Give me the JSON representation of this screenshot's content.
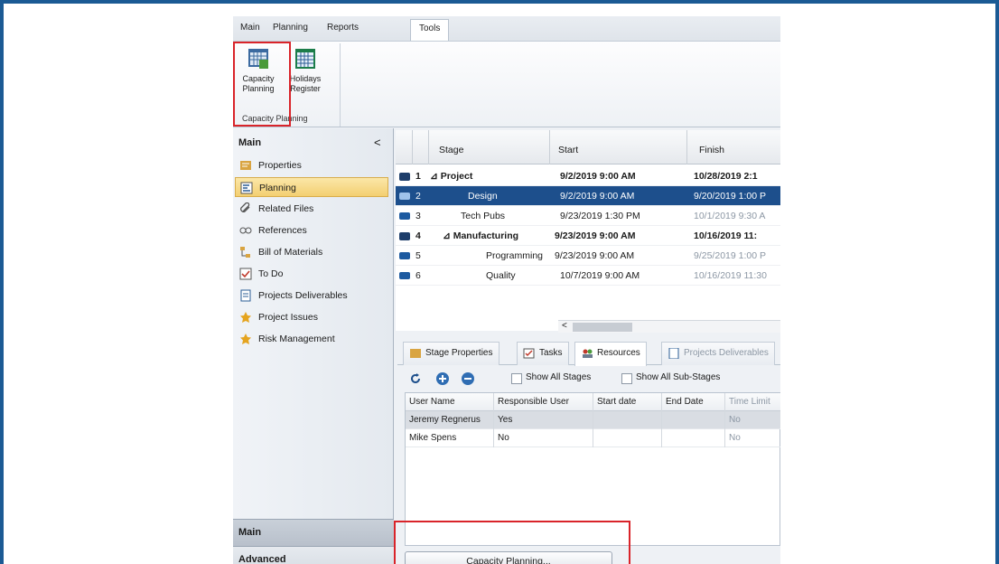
{
  "ribbon": {
    "tabs": [
      "Main",
      "Planning",
      "Reports",
      "Tools"
    ],
    "active_tab": "Tools",
    "buttons": [
      {
        "line1": "Capacity",
        "line2": "Planning"
      },
      {
        "line1": "Holidays",
        "line2": "Register"
      }
    ],
    "group_label": "Capacity Planning"
  },
  "nav": {
    "header": "Main",
    "collapse_glyph": "<",
    "items": [
      {
        "label": "Properties",
        "icon": "properties-icon"
      },
      {
        "label": "Planning",
        "icon": "planning-icon"
      },
      {
        "label": "Related Files",
        "icon": "paperclip-icon"
      },
      {
        "label": "References",
        "icon": "link-icon"
      },
      {
        "label": "Bill of Materials",
        "icon": "hierarchy-icon"
      },
      {
        "label": "To Do",
        "icon": "checkbox-icon"
      },
      {
        "label": "Projects Deliverables",
        "icon": "document-icon"
      },
      {
        "label": "Project Issues",
        "icon": "star-icon"
      },
      {
        "label": "Risk Management",
        "icon": "star-icon"
      }
    ],
    "selected": "Planning",
    "bottom_main": "Main",
    "bottom_advanced": "Advanced"
  },
  "stage_grid": {
    "headers": {
      "stage": "Stage",
      "start": "Start",
      "finish": "Finish"
    },
    "rows": [
      {
        "num": "1",
        "stage": "⊿ Project",
        "start": "9/2/2019 9:00 AM",
        "finish": "10/28/2019 2:1"
      },
      {
        "num": "2",
        "stage": "Design",
        "start": "9/2/2019 9:00 AM",
        "finish": "9/20/2019 1:00 P"
      },
      {
        "num": "3",
        "stage": "Tech Pubs",
        "start": "9/23/2019 1:30 PM",
        "finish": "10/1/2019 9:30 A"
      },
      {
        "num": "4",
        "stage": "⊿ Manufacturing",
        "start": "9/23/2019 9:00 AM",
        "finish": "10/16/2019 11:"
      },
      {
        "num": "5",
        "stage": "Programming",
        "start": "9/23/2019 9:00 AM",
        "finish": "9/25/2019 1:00 P"
      },
      {
        "num": "6",
        "stage": "Quality",
        "start": "10/7/2019 9:00 AM",
        "finish": "10/16/2019 11:30"
      }
    ],
    "scroll_arrow": "<"
  },
  "panel": {
    "tabs": [
      "Stage Properties",
      "Tasks",
      "Resources",
      "Projects Deliverables"
    ],
    "active_tab": "Resources",
    "toolbar": {
      "show_all_stages": "Show All Stages",
      "show_all_sub_stages": "Show All Sub-Stages"
    },
    "table": {
      "headers": [
        "User Name",
        "Responsible User",
        "Start date",
        "End Date",
        "Time Limit"
      ],
      "rows": [
        [
          "Jeremy Regnerus",
          "Yes",
          "",
          "",
          "No"
        ],
        [
          "Mike Spens",
          "No",
          "",
          "",
          "No"
        ]
      ]
    },
    "capacity_button": "Capacity Planning..."
  },
  "colors": {
    "frame": "#1b5a94",
    "highlight": "#d9242a",
    "selection": "#1d4f8c"
  }
}
